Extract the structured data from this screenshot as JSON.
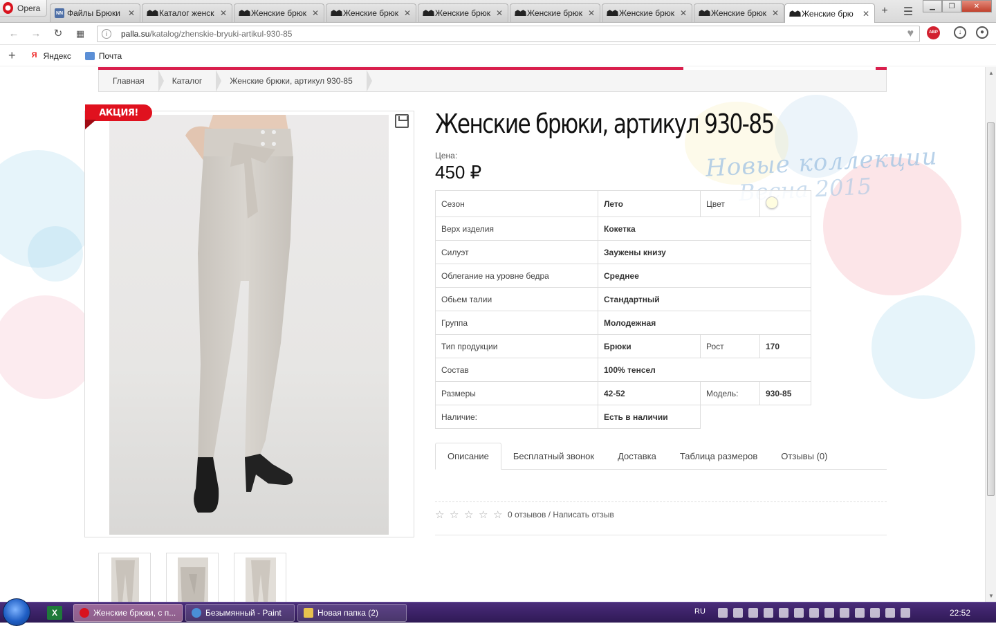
{
  "browser": {
    "menu_label": "Opera",
    "tabs": [
      {
        "label": "Файлы Брюки",
        "icon": "nn-icon"
      },
      {
        "label": "Каталог женск",
        "icon": "palla-icon"
      },
      {
        "label": "Женские брюк",
        "icon": "palla-icon"
      },
      {
        "label": "Женские брюк",
        "icon": "palla-icon"
      },
      {
        "label": "Женские брюк",
        "icon": "palla-icon"
      },
      {
        "label": "Женские брюк",
        "icon": "palla-icon"
      },
      {
        "label": "Женские брюк",
        "icon": "palla-icon"
      },
      {
        "label": "Женские брюк",
        "icon": "palla-icon"
      },
      {
        "label": "Женские брю",
        "icon": "palla-icon",
        "active": true
      }
    ],
    "url_host": "palla.su",
    "url_path": "/katalog/zhenskie-bryuki-artikul-930-85",
    "abp_label": "ABP",
    "bookmarks": [
      {
        "label": "Яндекс",
        "icon": "yandex-icon"
      },
      {
        "label": "Почта",
        "icon": "mail-icon"
      }
    ]
  },
  "breadcrumb": [
    "Главная",
    "Каталог",
    "Женские брюки, артикул 930-85"
  ],
  "promo_badge": "АКЦИЯ!",
  "product": {
    "title": "Женские брюки, артикул 930-85",
    "price_label": "Цена:",
    "price": "450 ₽",
    "decor_line1": "Новые коллекции",
    "decor_line2": "Весна 2015",
    "specs": {
      "season_label": "Сезон",
      "season_value": "Лето",
      "color_label": "Цвет",
      "color_hex": "#fffde0",
      "top_label": "Верх изделия",
      "top_value": "Кокетка",
      "silhouette_label": "Силуэт",
      "silhouette_value": "Заужены книзу",
      "hip_label": "Облегание на уровне бедра",
      "hip_value": "Среднее",
      "waist_label": "Обьем талии",
      "waist_value": "Стандартный",
      "group_label": "Группа",
      "group_value": "Молодежная",
      "type_label": "Тип продукции",
      "type_value": "Брюки",
      "height_label": "Рост",
      "height_value": "170",
      "composition_label": "Состав",
      "composition_value": "100% тенсел",
      "sizes_label": "Размеры",
      "sizes_value": "42-52",
      "model_label": "Модель:",
      "model_value": "930-85",
      "stock_label": "Наличие:",
      "stock_value": "Есть в наличии"
    },
    "tabs": [
      "Описание",
      "Бесплатный звонок",
      "Доставка",
      "Таблица размеров",
      "Отзывы (0)"
    ],
    "rating": 0,
    "reviews_text": "0 отзывов / Написать отзыв"
  },
  "taskbar": {
    "items": [
      {
        "label": "Женские брюки, с п...",
        "active": true
      },
      {
        "label": "Безымянный - Paint"
      },
      {
        "label": "Новая папка (2)"
      }
    ],
    "excel_label": "X",
    "lang": "RU",
    "time": "22:52"
  },
  "colors": {
    "accent": "#d91f4d",
    "promo": "#e0111e",
    "taskbar": "#3b2166"
  }
}
